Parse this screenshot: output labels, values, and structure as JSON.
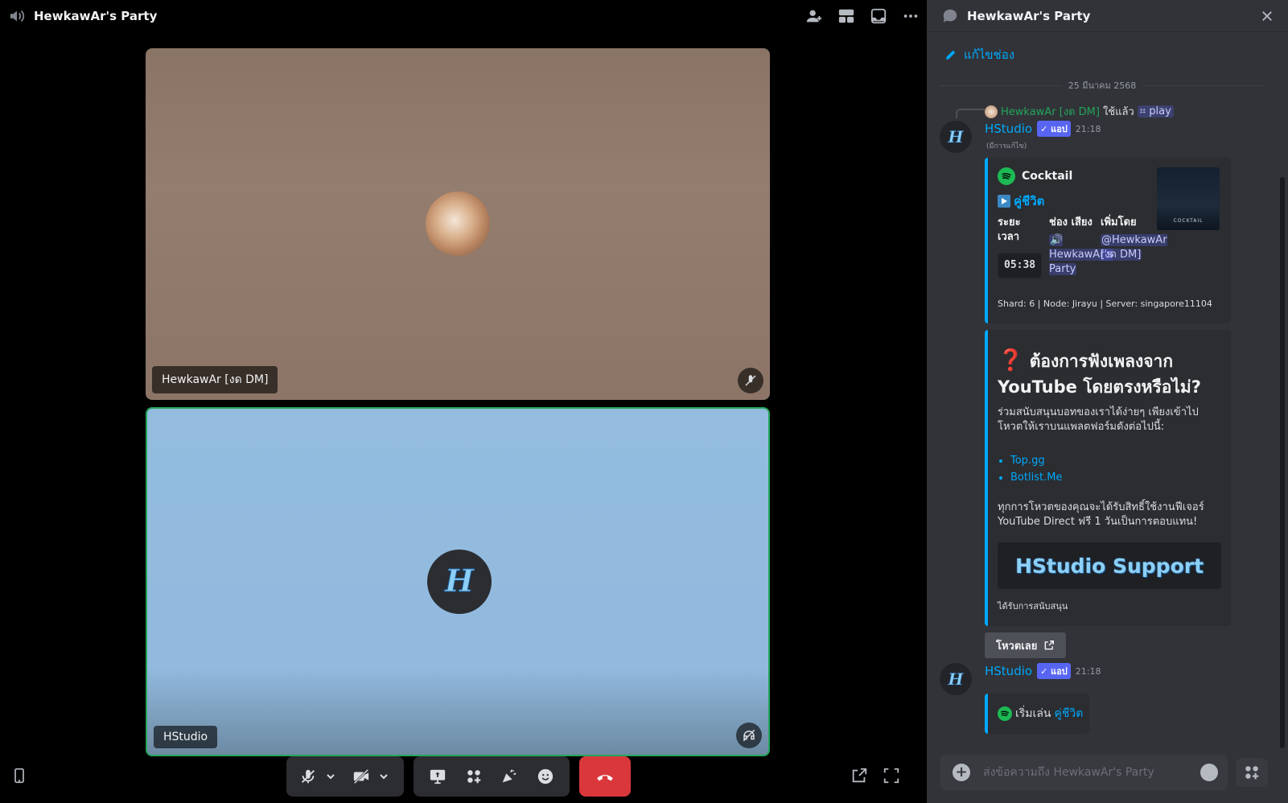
{
  "call": {
    "title": "HewkawAr's Party",
    "tile1_name": "HewkawAr [งด DM]",
    "tile2_name": "HStudio"
  },
  "chat": {
    "title": "HewkawAr's Party",
    "edit_label": "แก้ไขช่อง",
    "date": "25 มีนาคม 2568",
    "reply": {
      "user": "HewkawAr [งด DM]",
      "used": "ใช้แล้ว",
      "command": "play"
    },
    "msg1": {
      "author": "HStudio",
      "badge": "✓ แอป",
      "time": "21:18",
      "edited": "(มีการแก้ไข)",
      "embed": {
        "author": "Cocktail",
        "title": "คู่ชีวิต",
        "f1_name": "ระยะ เวลา",
        "f1_value": "05:38",
        "f2_name": "ช่อง เสียง",
        "f2_value": "🔊 HewkawAr's Party",
        "f3_name": "เพิ่มโดย",
        "f3_value": "@HewkawAr [งด DM]",
        "footer": "Shard: 6 | Node: Jirayu | Server: singapore11104",
        "thumb_text": "COCKTAIL"
      },
      "embed2": {
        "title": "ต้องการฟังเพลงจาก YouTube โดยตรงหรือไม่?",
        "desc": "ร่วมสนับสนุนบอทของเราได้ง่ายๆ เพียงเข้าไปโหวตให้เราบนแพลตฟอร์มดังต่อไปนี้:",
        "links": [
          "Top.gg",
          "Botlist.Me"
        ],
        "desc2": "ทุกการโหวตของคุณจะได้รับสิทธิ์ใช้งานฟีเจอร์ YouTube Direct ฟรี 1 วันเป็นการตอบแทน!",
        "banner": "HStudio Support",
        "footer": "ได้รับการสนับสนุน"
      },
      "button": "โหวตเลย"
    },
    "msg2": {
      "author": "HStudio",
      "badge": "✓ แอป",
      "time": "21:18",
      "prefix": "เริ่มเล่น",
      "song": "คู่ชีวิต"
    },
    "composer_placeholder": "ส่งข้อความถึง HewkawAr's Party"
  },
  "colors": {
    "accent": "#00a8fc",
    "speaking": "#23a55a",
    "hangup": "#da373c",
    "spotify": "#1db954"
  }
}
